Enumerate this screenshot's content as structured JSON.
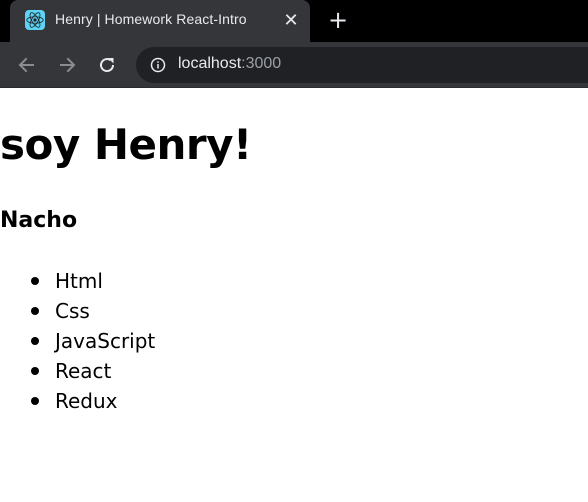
{
  "browser": {
    "tab": {
      "title": "Henry | Homework React-Intro",
      "favicon": "react-logo-icon",
      "close_glyph": "✕"
    },
    "new_tab_glyph": "+",
    "toolbar": {
      "back_icon": "arrow-left-icon",
      "forward_icon": "arrow-right-icon",
      "reload_icon": "reload-icon"
    },
    "address": {
      "host": "localhost",
      "port": ":3000",
      "info_icon": "info-icon"
    },
    "colors": {
      "tabstrip": "#000000",
      "active_tab": "#35363a",
      "toolbar": "#35363a",
      "omnibox": "#202124",
      "text": "#e8eaed",
      "muted": "#9aa0a6",
      "react": "#61dafb"
    }
  },
  "page": {
    "title": "soy Henry!",
    "name": "Nacho",
    "skills": [
      "Html",
      "Css",
      "JavaScript",
      "React",
      "Redux"
    ]
  }
}
